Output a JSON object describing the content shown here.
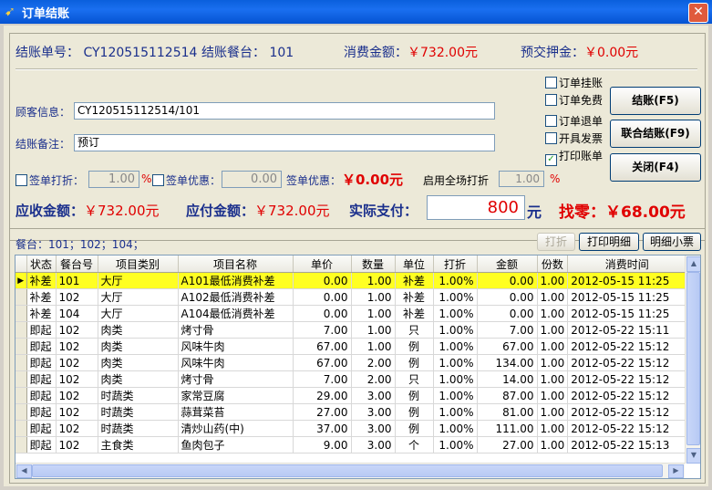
{
  "window": {
    "title": "订单结账",
    "close_glyph": "✕",
    "app_icon": "red-arrow-icon"
  },
  "header": {
    "bill_no_label": "结账单号：",
    "bill_no": "CY120515112514",
    "table_label": "结账餐台：",
    "table": "101",
    "amount_label": "消费金额：",
    "amount": "￥732.00元",
    "deposit_label": "预交押金：",
    "deposit": "￥0.00元"
  },
  "form": {
    "customer_label": "顾客信息：",
    "customer_value": "CY120515112514/101",
    "note_label": "结账备注：",
    "note_value": "预订",
    "sign_discount_label": "签单打折：",
    "sign_discount_value": "1.00",
    "pct": "%",
    "sign_offer_label": "签单优惠：",
    "sign_offer_value": "0.00",
    "sign_offer_amount_label": "签单优惠：",
    "sign_offer_amount": "￥0.00元",
    "global_discount_label": "启用全场打折",
    "global_discount_value": "1.00",
    "pct2": "%"
  },
  "options": [
    {
      "label": "订单挂账",
      "checked": false
    },
    {
      "label": "订单免费",
      "checked": false
    },
    {
      "label": "订单退单",
      "checked": false
    },
    {
      "label": "开具发票",
      "checked": false
    },
    {
      "label": "打印账单",
      "checked": true
    }
  ],
  "buttons": {
    "checkout": "结账(F5)",
    "joint_checkout": "联合结账(F9)",
    "close": "关闭(F4)"
  },
  "totals": {
    "receivable_label": "应收金额：",
    "receivable": "￥732.00元",
    "payable_label": "应付金额：",
    "payable": "￥732.00元",
    "actual_label": "实际支付：",
    "actual": "800",
    "actual_unit": "元",
    "change_label": "找零：",
    "change": "￥68.00元"
  },
  "table_section": {
    "tables_label": "餐台：101；102；104；",
    "discount_btn": "打折",
    "print_detail_btn": "打印明细",
    "detail_ticket_btn": "明细小票"
  },
  "grid": {
    "columns": [
      "状态",
      "餐台号",
      "项目类别",
      "项目名称",
      "单价",
      "数量",
      "单位",
      "打折",
      "金额",
      "份数",
      "消费时间"
    ],
    "rows": [
      [
        "补差",
        "101",
        "大厅",
        "A101最低消费补差",
        "0.00",
        "1.00",
        "补差",
        "1.00%",
        "0.00",
        "1.00",
        "2012-05-15 11:25"
      ],
      [
        "补差",
        "102",
        "大厅",
        "A102最低消费补差",
        "0.00",
        "1.00",
        "补差",
        "1.00%",
        "0.00",
        "1.00",
        "2012-05-15 11:25"
      ],
      [
        "补差",
        "104",
        "大厅",
        "A104最低消费补差",
        "0.00",
        "1.00",
        "补差",
        "1.00%",
        "0.00",
        "1.00",
        "2012-05-15 11:25"
      ],
      [
        "即起",
        "102",
        "肉类",
        "烤寸骨",
        "7.00",
        "1.00",
        "只",
        "1.00%",
        "7.00",
        "1.00",
        "2012-05-22 15:11"
      ],
      [
        "即起",
        "102",
        "肉类",
        "风味牛肉",
        "67.00",
        "1.00",
        "例",
        "1.00%",
        "67.00",
        "1.00",
        "2012-05-22 15:12"
      ],
      [
        "即起",
        "102",
        "肉类",
        "风味牛肉",
        "67.00",
        "2.00",
        "例",
        "1.00%",
        "134.00",
        "1.00",
        "2012-05-22 15:12"
      ],
      [
        "即起",
        "102",
        "肉类",
        "烤寸骨",
        "7.00",
        "2.00",
        "只",
        "1.00%",
        "14.00",
        "1.00",
        "2012-05-22 15:12"
      ],
      [
        "即起",
        "102",
        "时蔬类",
        "家常豆腐",
        "29.00",
        "3.00",
        "例",
        "1.00%",
        "87.00",
        "1.00",
        "2012-05-22 15:12"
      ],
      [
        "即起",
        "102",
        "时蔬类",
        "蒜茸菜苔",
        "27.00",
        "3.00",
        "例",
        "1.00%",
        "81.00",
        "1.00",
        "2012-05-22 15:12"
      ],
      [
        "即起",
        "102",
        "时蔬类",
        "清炒山药(中)",
        "37.00",
        "3.00",
        "例",
        "1.00%",
        "111.00",
        "1.00",
        "2012-05-22 15:12"
      ],
      [
        "即起",
        "102",
        "主食类",
        "鱼肉包子",
        "9.00",
        "3.00",
        "个",
        "1.00%",
        "27.00",
        "1.00",
        "2012-05-22 15:13"
      ]
    ],
    "selected_row": 0
  }
}
